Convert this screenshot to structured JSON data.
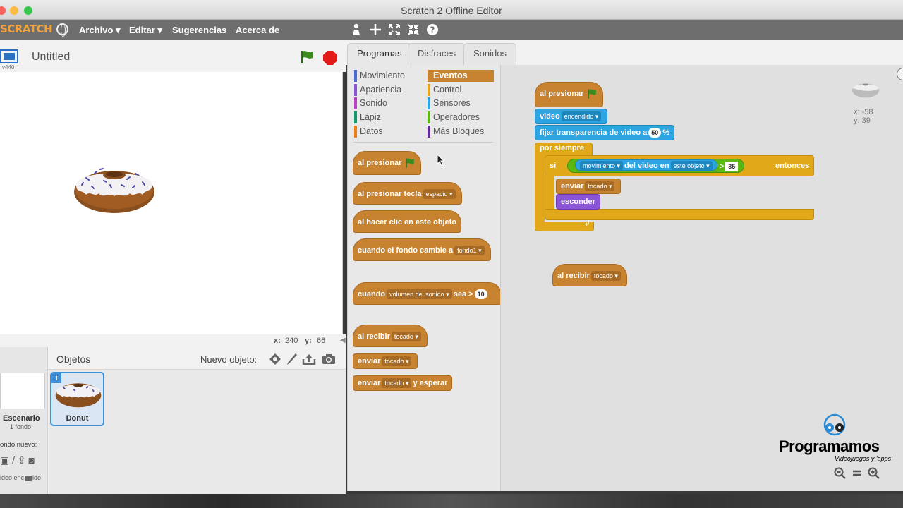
{
  "window": {
    "title": "Scratch 2 Offline Editor"
  },
  "menubar": {
    "logo": "SCRATCH",
    "items": [
      "Archivo ▾",
      "Editar ▾",
      "Sugerencias",
      "Acerca de"
    ]
  },
  "stage": {
    "project_title": "Untitled",
    "version": "v440",
    "coord_x_label": "x:",
    "coord_x": "240",
    "coord_y_label": "y:",
    "coord_y": "66"
  },
  "sprites_pane": {
    "header": "Objetos",
    "new_sprite_label": "Nuevo objeto:",
    "stage_label": "Escenario",
    "stage_backdrops": "1 fondo",
    "new_backdrop_label": "ondo nuevo:",
    "video_label": "ideo enc",
    "video_label2": "ido",
    "sprite_name": "Donut"
  },
  "tabs": [
    "Programas",
    "Disfraces",
    "Sonidos"
  ],
  "categories": [
    {
      "label": "Movimiento",
      "color": "#4a6cd4"
    },
    {
      "label": "Apariencia",
      "color": "#8a55d7"
    },
    {
      "label": "Sonido",
      "color": "#bb42c3"
    },
    {
      "label": "Lápiz",
      "color": "#0e9a6c"
    },
    {
      "label": "Datos",
      "color": "#ee7d16"
    },
    {
      "label": "Eventos",
      "color": "#c88330"
    },
    {
      "label": "Control",
      "color": "#e1a91a"
    },
    {
      "label": "Sensores",
      "color": "#2ca5e2"
    },
    {
      "label": "Operadores",
      "color": "#5cb712"
    },
    {
      "label": "Más Bloques",
      "color": "#632d99"
    }
  ],
  "palette_blocks": {
    "when_flag": "al presionar",
    "when_key": "al presionar tecla",
    "when_key_dd": "espacio",
    "when_click": "al hacer clic en este objeto",
    "when_backdrop": "cuando el fondo cambie a",
    "when_backdrop_dd": "fondo1",
    "when_sensor": "cuando",
    "when_sensor_dd": "volumen del sonido",
    "when_sensor_op": "sea >",
    "when_sensor_val": "10",
    "when_receive": "al recibir",
    "when_receive_dd": "tocado",
    "broadcast": "enviar",
    "broadcast_dd": "tocado",
    "broadcast_wait": "enviar",
    "broadcast_wait_dd": "tocado",
    "broadcast_wait_suffix": "y esperar"
  },
  "script": {
    "hat": "al presionar",
    "video": "video",
    "video_dd": "encendido",
    "transparency": "fijar transparencia de video a",
    "transparency_val": "50",
    "transparency_unit": "%",
    "forever": "por siempre",
    "if": "si",
    "sensing_dd": "movimiento",
    "sensing_mid": "del video en",
    "sensing_dd2": "este objeto",
    "gt": ">",
    "gt_val": "35",
    "then": "entonces",
    "send": "enviar",
    "send_dd": "tocado",
    "hide": "esconder",
    "receive": "al recibir",
    "receive_dd": "tocado"
  },
  "sprite_info": {
    "x": "x: -58",
    "y": "y: 39"
  },
  "watermark": {
    "name": "Programamos",
    "tagline": "Videojuegos y 'apps'"
  },
  "zoom": {
    "out": "−",
    "reset": "=",
    "in": "+"
  }
}
